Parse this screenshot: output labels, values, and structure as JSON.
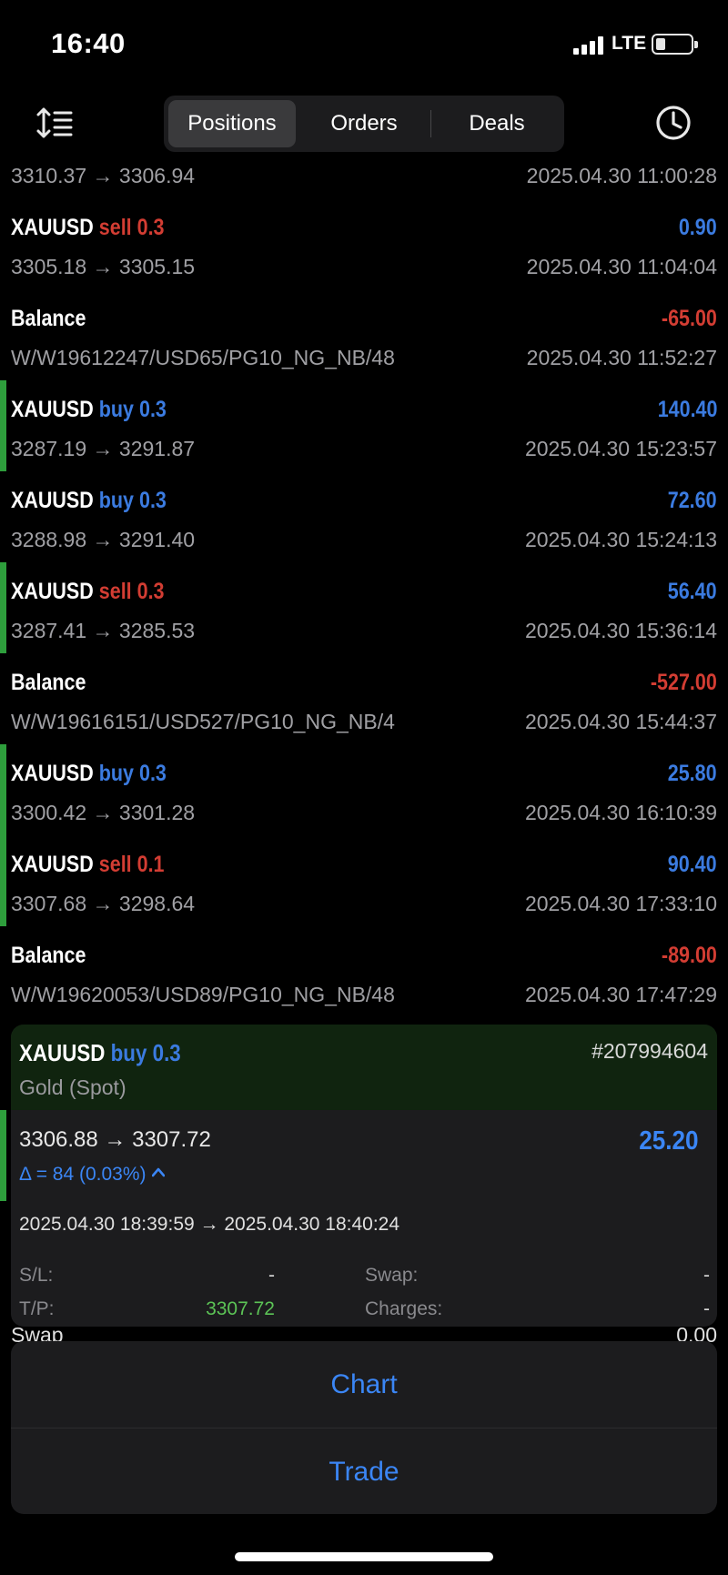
{
  "status_bar": {
    "time": "16:40",
    "network": "LTE"
  },
  "tabs": [
    {
      "label": "Positions",
      "active": true
    },
    {
      "label": "Orders",
      "active": false
    },
    {
      "label": "Deals",
      "active": false
    }
  ],
  "deals": [
    {
      "type": "trade",
      "symbol": "",
      "side": "",
      "volume": "",
      "profit": "",
      "profit_sign": "pos",
      "prices": "3310.37 → 3306.94",
      "time": "2025.04.30 11:00:28",
      "accent": false
    },
    {
      "type": "trade",
      "symbol": "XAUUSD",
      "side": "sell",
      "volume": "0.3",
      "profit": "0.90",
      "profit_sign": "pos",
      "prices": "3305.18 → 3305.15",
      "time": "2025.04.30 11:04:04",
      "accent": false
    },
    {
      "type": "balance",
      "symbol": "Balance",
      "side": "",
      "volume": "",
      "profit": "-65.00",
      "profit_sign": "neg",
      "prices": "W/W19612247/USD65/PG10_NG_NB/48",
      "time": "2025.04.30 11:52:27",
      "accent": false
    },
    {
      "type": "trade",
      "symbol": "XAUUSD",
      "side": "buy",
      "volume": "0.3",
      "profit": "140.40",
      "profit_sign": "pos",
      "prices": "3287.19 → 3291.87",
      "time": "2025.04.30 15:23:57",
      "accent": true
    },
    {
      "type": "trade",
      "symbol": "XAUUSD",
      "side": "buy",
      "volume": "0.3",
      "profit": "72.60",
      "profit_sign": "pos",
      "prices": "3288.98 → 3291.40",
      "time": "2025.04.30 15:24:13",
      "accent": false
    },
    {
      "type": "trade",
      "symbol": "XAUUSD",
      "side": "sell",
      "volume": "0.3",
      "profit": "56.40",
      "profit_sign": "pos",
      "prices": "3287.41 → 3285.53",
      "time": "2025.04.30 15:36:14",
      "accent": true
    },
    {
      "type": "balance",
      "symbol": "Balance",
      "side": "",
      "volume": "",
      "profit": "-527.00",
      "profit_sign": "neg",
      "prices": "W/W19616151/USD527/PG10_NG_NB/4",
      "time": "2025.04.30 15:44:37",
      "accent": false
    },
    {
      "type": "trade",
      "symbol": "XAUUSD",
      "side": "buy",
      "volume": "0.3",
      "profit": "25.80",
      "profit_sign": "pos",
      "prices": "3300.42 → 3301.28",
      "time": "2025.04.30 16:10:39",
      "accent": true
    },
    {
      "type": "trade",
      "symbol": "XAUUSD",
      "side": "sell",
      "volume": "0.1",
      "profit": "90.40",
      "profit_sign": "pos",
      "prices": "3307.68 → 3298.64",
      "time": "2025.04.30 17:33:10",
      "accent": true
    },
    {
      "type": "balance",
      "symbol": "Balance",
      "side": "",
      "volume": "",
      "profit": "-89.00",
      "profit_sign": "neg",
      "prices": "W/W19620053/USD89/PG10_NG_NB/48",
      "time": "2025.04.30 17:47:29",
      "accent": false
    }
  ],
  "detail": {
    "symbol": "XAUUSD",
    "side": "buy",
    "volume": "0.3",
    "ticket": "#207994604",
    "description": "Gold (Spot)",
    "prices": "3306.88 → 3307.72",
    "profit": "25.20",
    "delta": "Δ = 84 (0.03%)",
    "times": "2025.04.30 18:39:59 → 2025.04.30 18:40:24",
    "sl_label": "S/L:",
    "sl_value": "-",
    "tp_label": "T/P:",
    "tp_value": "3307.72",
    "swap_label": "Swap:",
    "swap_value": "-",
    "charges_label": "Charges:",
    "charges_value": "-"
  },
  "peek_row": {
    "label": "Swap",
    "value": "0.00"
  },
  "actions": {
    "chart": "Chart",
    "trade": "Trade"
  },
  "colors": {
    "sell": "#d33d33",
    "buy": "#3b7be0",
    "accent_green": "#2e9e3c",
    "link_blue": "#3b86f5"
  }
}
